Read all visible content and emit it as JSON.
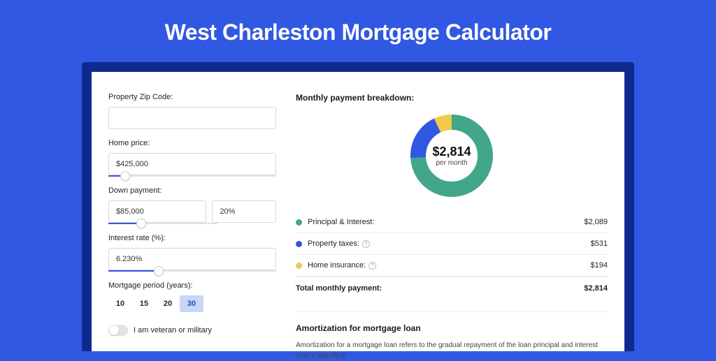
{
  "title": "West Charleston Mortgage Calculator",
  "colors": {
    "principal": "#41a68a",
    "taxes": "#3158e2",
    "insurance": "#f2c94c"
  },
  "form": {
    "zip": {
      "label": "Property Zip Code:",
      "value": ""
    },
    "homePrice": {
      "label": "Home price:",
      "value": "$425,000",
      "sliderPct": 10
    },
    "downPayment": {
      "label": "Down payment:",
      "amount": "$85,000",
      "pct": "20%",
      "sliderPct": 20
    },
    "interestRate": {
      "label": "Interest rate (%):",
      "value": "6.230%",
      "sliderPct": 30
    },
    "period": {
      "label": "Mortgage period (years):",
      "options": [
        "10",
        "15",
        "20",
        "30"
      ],
      "active": "30"
    },
    "veteran": {
      "label": "I am veteran or military",
      "on": false
    }
  },
  "breakdown": {
    "title": "Monthly payment breakdown:",
    "centerAmount": "$2,814",
    "centerSub": "per month",
    "items": [
      {
        "key": "principal",
        "label": "Principal & Interest:",
        "value": "$2,089",
        "info": false,
        "pct": 74
      },
      {
        "key": "taxes",
        "label": "Property taxes:",
        "value": "$531",
        "info": true,
        "pct": 19
      },
      {
        "key": "insurance",
        "label": "Home insurance:",
        "value": "$194",
        "info": true,
        "pct": 7
      }
    ],
    "totalLabel": "Total monthly payment:",
    "totalValue": "$2,814"
  },
  "amort": {
    "title": "Amortization for mortgage loan",
    "text": "Amortization for a mortgage loan refers to the gradual repayment of the loan principal and interest over a specified"
  },
  "chart_data": {
    "type": "pie",
    "title": "Monthly payment breakdown",
    "categories": [
      "Principal & Interest",
      "Property taxes",
      "Home insurance"
    ],
    "values": [
      2089,
      531,
      194
    ],
    "total": 2814,
    "unit": "USD/month"
  }
}
